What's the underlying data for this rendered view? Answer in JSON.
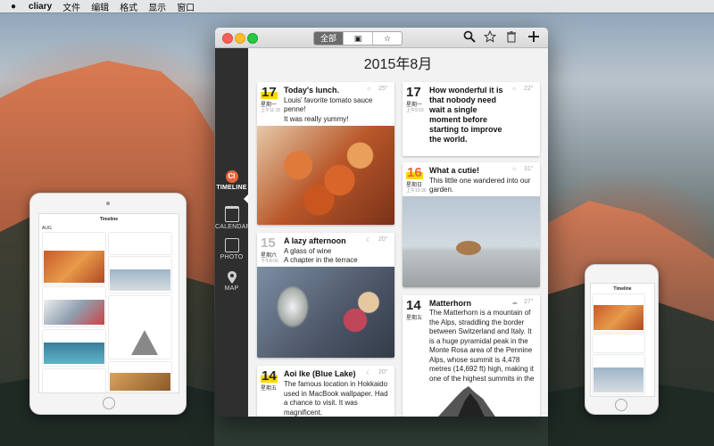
{
  "menubar": {
    "app_name": "cliary",
    "menus": [
      "文件",
      "编辑",
      "格式",
      "显示",
      "窗口"
    ]
  },
  "toolbar": {
    "segments": [
      {
        "label": "全部",
        "active": true
      },
      {
        "label": "▣",
        "active": false
      },
      {
        "label": "☆",
        "active": false
      }
    ]
  },
  "sidebar": {
    "items": [
      {
        "label": "TIMELINE",
        "icon": "cliary-logo-icon",
        "active": true
      },
      {
        "label": "CALENDAR",
        "icon": "calendar-icon",
        "active": false
      },
      {
        "label": "PHOTO",
        "icon": "photo-icon",
        "active": false
      },
      {
        "label": "MAP",
        "icon": "map-pin-icon",
        "active": false
      }
    ]
  },
  "timeline": {
    "month_title": "2015年8月",
    "entries": [
      {
        "day": "17",
        "weekday": "星期一",
        "time": "上午11:15",
        "title": "Today's lunch.",
        "text": [
          "Louis' favorite tomato sauce",
          "penne!",
          "It was really yummy!"
        ],
        "temp": "25°",
        "highlight": true
      },
      {
        "day": "17",
        "weekday": "星期一",
        "time": "上午9:15",
        "title": "How wonderful it is that nobody need wait a single moment before starting to improve the world.",
        "text": [],
        "temp": "22°",
        "highlight": false
      },
      {
        "day": "16",
        "weekday": "星期日",
        "time": "上午10:30",
        "title": "What a cutie!",
        "text": [
          "This little one wandered into our",
          "garden."
        ],
        "temp": "31°",
        "highlight": true
      },
      {
        "day": "15",
        "weekday": "星期六",
        "time": "下午8:00",
        "title": "A lazy afternoon",
        "text": [
          "A glass of wine",
          "A chapter in the terrace"
        ],
        "temp": "20°",
        "highlight": false,
        "grey": true
      },
      {
        "day": "14",
        "weekday": "星期五",
        "time": "",
        "title": "Matterhorn",
        "text": [
          "The Matterhorn is a mountain of",
          "the Alps, straddling the border",
          "between Switzerland and Italy. It",
          "is a huge pyramidal peak in the",
          "Monte Rosa area of the Pennine",
          "Alps, whose summit is 4,478",
          "metres (14,692 ft) high, making it",
          "one of the highest summits in the"
        ],
        "temp": "27°",
        "highlight": false
      },
      {
        "day": "14",
        "weekday": "星期五",
        "time": "",
        "title": "Aoi Ike (Blue Lake)",
        "text": [
          "The famous location in Hokkaido",
          "used in MacBook wallpaper. Had",
          "a chance to visit. It was",
          "magnificent."
        ],
        "temp": "20°",
        "highlight": true
      }
    ]
  },
  "ipad": {
    "title": "Timeline",
    "month": "AUG"
  },
  "iphone": {
    "title": "Timeline"
  }
}
